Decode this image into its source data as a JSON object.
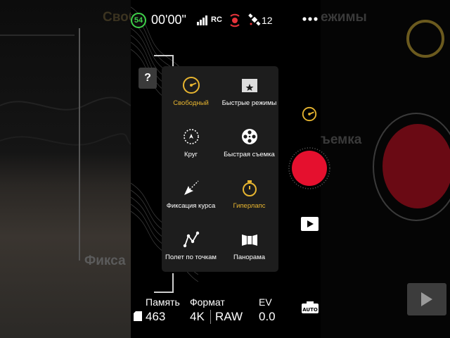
{
  "background": {
    "left_ghost_top": "Своб",
    "left_ghost_bottom": "Фикса",
    "right_ghost_top": "ежимы",
    "right_ghost_mid": "ъемка"
  },
  "status": {
    "battery": "54",
    "timer": "00'00\"",
    "rc_label": "RC",
    "satellites": "12",
    "accent_green": "#3fd04a",
    "accent_red": "#e8333a"
  },
  "help_label": "?",
  "modes": [
    {
      "label": "Свободный",
      "icon": "free-mode-icon",
      "active": true
    },
    {
      "label": "Быстрые режимы",
      "icon": "clapperboard-star-icon",
      "active": false
    },
    {
      "label": "Круг",
      "icon": "circle-orbit-icon",
      "active": false
    },
    {
      "label": "Быстрая съемка",
      "icon": "film-reel-icon",
      "active": false
    },
    {
      "label": "Фиксация курса",
      "icon": "course-lock-icon",
      "active": false
    },
    {
      "label": "Гиперлапс",
      "icon": "stopwatch-icon",
      "active": true
    },
    {
      "label": "Полет по точкам",
      "icon": "waypoints-icon",
      "active": false
    },
    {
      "label": "Панорама",
      "icon": "panorama-icon",
      "active": false
    }
  ],
  "active_color": "#e7b530",
  "shutter_color": "#e5102e",
  "bottom": {
    "memory_label": "Память",
    "memory_value": "463",
    "format_label": "Формат",
    "format_res": "4K",
    "format_type": "RAW",
    "ev_label": "EV",
    "ev_value": "0.0"
  },
  "auto_label": "AUTO"
}
